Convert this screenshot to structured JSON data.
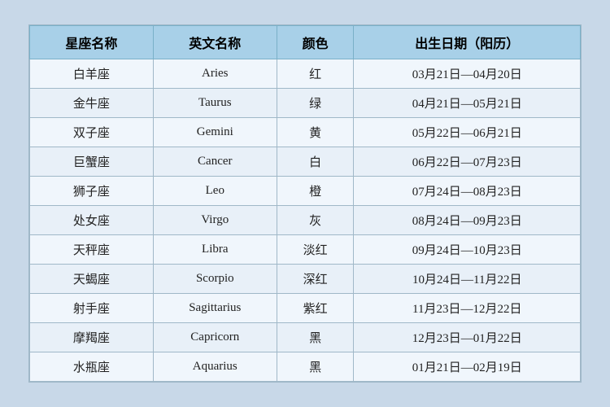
{
  "table": {
    "headers": [
      "星座名称",
      "英文名称",
      "颜色",
      "出生日期（阳历）"
    ],
    "rows": [
      {
        "chinese": "白羊座",
        "english": "Aries",
        "color": "红",
        "dates": "03月21日—04月20日"
      },
      {
        "chinese": "金牛座",
        "english": "Taurus",
        "color": "绿",
        "dates": "04月21日—05月21日"
      },
      {
        "chinese": "双子座",
        "english": "Gemini",
        "color": "黄",
        "dates": "05月22日—06月21日"
      },
      {
        "chinese": "巨蟹座",
        "english": "Cancer",
        "color": "白",
        "dates": "06月22日—07月23日"
      },
      {
        "chinese": "狮子座",
        "english": "Leo",
        "color": "橙",
        "dates": "07月24日—08月23日"
      },
      {
        "chinese": "处女座",
        "english": "Virgo",
        "color": "灰",
        "dates": "08月24日—09月23日"
      },
      {
        "chinese": "天秤座",
        "english": "Libra",
        "color": "淡红",
        "dates": "09月24日—10月23日"
      },
      {
        "chinese": "天蝎座",
        "english": "Scorpio",
        "color": "深红",
        "dates": "10月24日—11月22日"
      },
      {
        "chinese": "射手座",
        "english": "Sagittarius",
        "color": "紫红",
        "dates": "11月23日—12月22日"
      },
      {
        "chinese": "摩羯座",
        "english": "Capricorn",
        "color": "黑",
        "dates": "12月23日—01月22日"
      },
      {
        "chinese": "水瓶座",
        "english": "Aquarius",
        "color": "黑",
        "dates": "01月21日—02月19日"
      }
    ]
  }
}
